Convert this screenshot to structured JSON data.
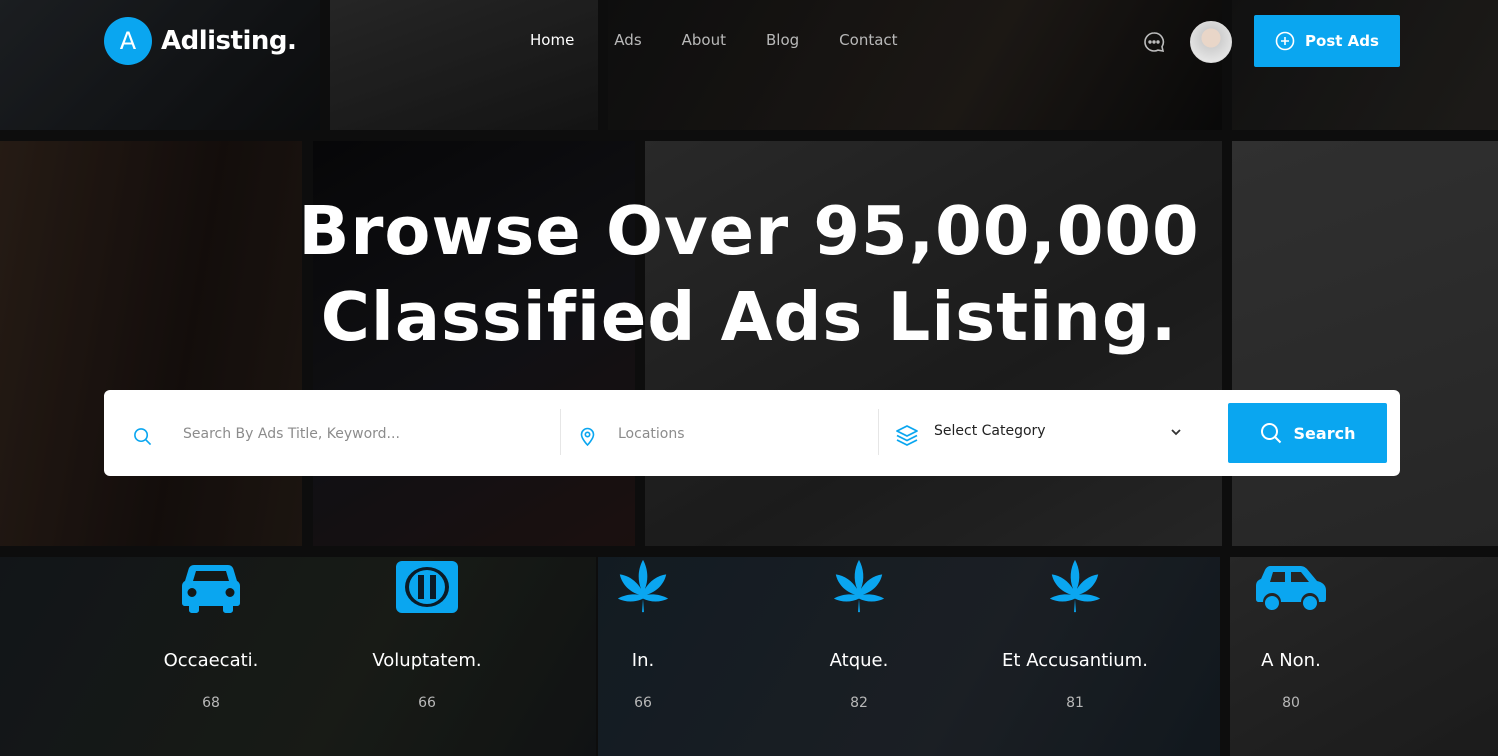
{
  "brand": {
    "logo_letter": "A",
    "name": "Adlisting."
  },
  "nav": [
    {
      "label": "Home"
    },
    {
      "label": "Ads"
    },
    {
      "label": "About"
    },
    {
      "label": "Blog"
    },
    {
      "label": "Contact"
    }
  ],
  "header": {
    "post_ads_label": "Post Ads"
  },
  "hero": {
    "title_line1": "Browse Over 95,00,000",
    "title_line2": "Classified Ads Listing."
  },
  "search": {
    "keyword_placeholder": "Search By Ads Title, Keyword...",
    "location_placeholder": "Locations",
    "category_selected": "Select Category",
    "button_label": "Search"
  },
  "categories": [
    {
      "name": "Occaecati.",
      "count": "68",
      "icon": "car-icon"
    },
    {
      "name": "Voluptatem.",
      "count": "66",
      "icon": "diners-club-icon"
    },
    {
      "name": "In.",
      "count": "66",
      "icon": "leaf-icon"
    },
    {
      "name": "Atque.",
      "count": "82",
      "icon": "leaf-icon"
    },
    {
      "name": "Et Accusantium.",
      "count": "81",
      "icon": "leaf-icon"
    },
    {
      "name": "A Non.",
      "count": "80",
      "icon": "car-side-icon"
    }
  ],
  "colors": {
    "accent": "#0aa6f0",
    "text_muted": "#b9b9b9"
  }
}
